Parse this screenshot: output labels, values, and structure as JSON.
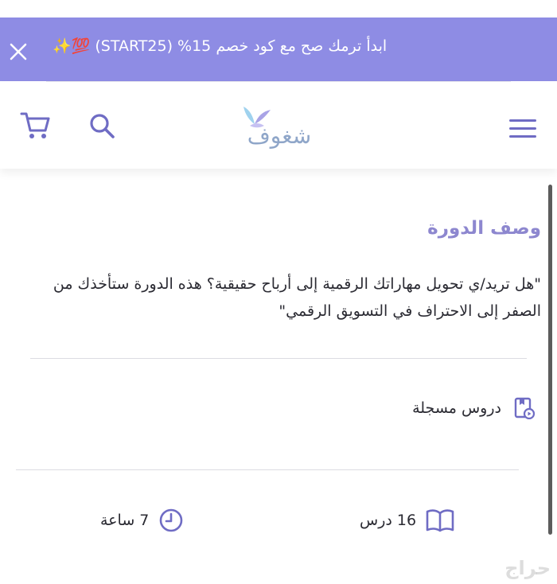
{
  "promo": {
    "text": "ابدأ ترمك صح مع كود خصم 15% (START25) 💯✨",
    "close_icon": "close-icon",
    "color": "#8e8ce4"
  },
  "header": {
    "logo_text": "شغوف",
    "menu_icon": "hamburger-menu-icon",
    "search_icon": "search-icon",
    "cart_icon": "cart-icon"
  },
  "course": {
    "section_title": "وصف الدورة",
    "description": "\"هل تريد/ي تحويل مهاراتك الرقمية إلى أرباح حقيقية؟ هذه الدورة ستأخذك من الصفر إلى الاحتراف في التسويق الرقمي\"",
    "recorded_label": "دروس مسجلة",
    "lessons": "16 درس",
    "hours": "7 ساعة",
    "accent_color": "#8d87cf"
  },
  "watermark": "حراج"
}
